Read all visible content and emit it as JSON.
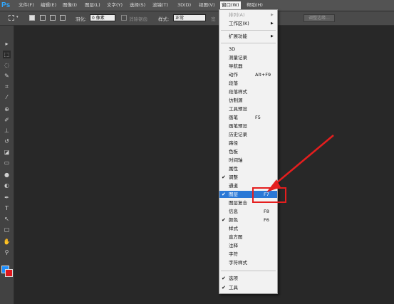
{
  "app": {
    "logo": "Ps"
  },
  "menubar": {
    "items": [
      {
        "label": "文件(F)"
      },
      {
        "label": "编辑(E)"
      },
      {
        "label": "图像(I)"
      },
      {
        "label": "图层(L)"
      },
      {
        "label": "文字(Y)"
      },
      {
        "label": "选择(S)"
      },
      {
        "label": "滤镜(T)"
      },
      {
        "label": "3D(D)"
      },
      {
        "label": "视图(V)"
      },
      {
        "label": "窗口(W)",
        "active": true
      },
      {
        "label": "帮助(H)"
      }
    ]
  },
  "options_bar": {
    "feather_label": "羽化:",
    "feather_value": "0 像素",
    "antialias_label": "消除锯齿",
    "style_label": "样式:",
    "style_value": "正常",
    "width_label": "宽",
    "refine_edge_button": "调整边缘..."
  },
  "window_menu": {
    "items": [
      {
        "label": "排列(A)",
        "submenu": true,
        "disabled": true
      },
      {
        "label": "工作区(K)",
        "submenu": true
      },
      {
        "separator": true
      },
      {
        "label": "扩展功能",
        "submenu": true
      },
      {
        "separator": true
      },
      {
        "label": "3D"
      },
      {
        "label": "测量记录"
      },
      {
        "label": "导航器"
      },
      {
        "label": "动作",
        "shortcut": "Alt+F9"
      },
      {
        "label": "段落"
      },
      {
        "label": "段落样式"
      },
      {
        "label": "仿制源"
      },
      {
        "label": "工具预设"
      },
      {
        "label": "画笔",
        "shortcut": "F5"
      },
      {
        "label": "画笔预设"
      },
      {
        "label": "历史记录"
      },
      {
        "label": "路径"
      },
      {
        "label": "色板"
      },
      {
        "label": "时间轴"
      },
      {
        "label": "属性"
      },
      {
        "label": "调整",
        "checked": true
      },
      {
        "label": "通道"
      },
      {
        "label": "图层",
        "shortcut": "F7",
        "checked": true,
        "highlighted": true
      },
      {
        "label": "图层复合"
      },
      {
        "label": "信息",
        "shortcut": "F8"
      },
      {
        "label": "颜色",
        "shortcut": "F6",
        "checked": true
      },
      {
        "label": "样式"
      },
      {
        "label": "直方图"
      },
      {
        "label": "注释"
      },
      {
        "label": "字符"
      },
      {
        "label": "字符样式"
      },
      {
        "separator": true
      },
      {
        "label": "选项",
        "checked": true
      },
      {
        "label": "工具",
        "checked": true
      }
    ]
  },
  "colors": {
    "accent_highlight": "#2a78d6",
    "annotation_red": "#e51e1e",
    "foreground_swatch": "#1e90ff",
    "background_swatch": "#e0161c"
  },
  "toolbar": {
    "tools": [
      {
        "name": "move-tool-icon",
        "glyph": "▸"
      },
      {
        "name": "marquee-tool-icon",
        "glyph": "⬚",
        "selected": true
      },
      {
        "name": "lasso-tool-icon",
        "glyph": "◌"
      },
      {
        "name": "quick-select-tool-icon",
        "glyph": "✎"
      },
      {
        "name": "crop-tool-icon",
        "glyph": "⌗"
      },
      {
        "name": "eyedropper-tool-icon",
        "glyph": "⁄"
      },
      {
        "name": "healing-brush-tool-icon",
        "glyph": "⊕"
      },
      {
        "name": "brush-tool-icon",
        "glyph": "✐"
      },
      {
        "name": "clone-stamp-tool-icon",
        "glyph": "⊥"
      },
      {
        "name": "history-brush-tool-icon",
        "glyph": "↺"
      },
      {
        "name": "eraser-tool-icon",
        "glyph": "◪"
      },
      {
        "name": "gradient-tool-icon",
        "glyph": "▭"
      },
      {
        "name": "blur-tool-icon",
        "glyph": "●"
      },
      {
        "name": "dodge-tool-icon",
        "glyph": "◐"
      },
      {
        "name": "pen-tool-icon",
        "glyph": "✒"
      },
      {
        "name": "type-tool-icon",
        "glyph": "T"
      },
      {
        "name": "path-select-tool-icon",
        "glyph": "↖"
      },
      {
        "name": "shape-tool-icon",
        "glyph": "▢"
      },
      {
        "name": "hand-tool-icon",
        "glyph": "✋"
      },
      {
        "name": "zoom-tool-icon",
        "glyph": "⚲"
      }
    ]
  }
}
